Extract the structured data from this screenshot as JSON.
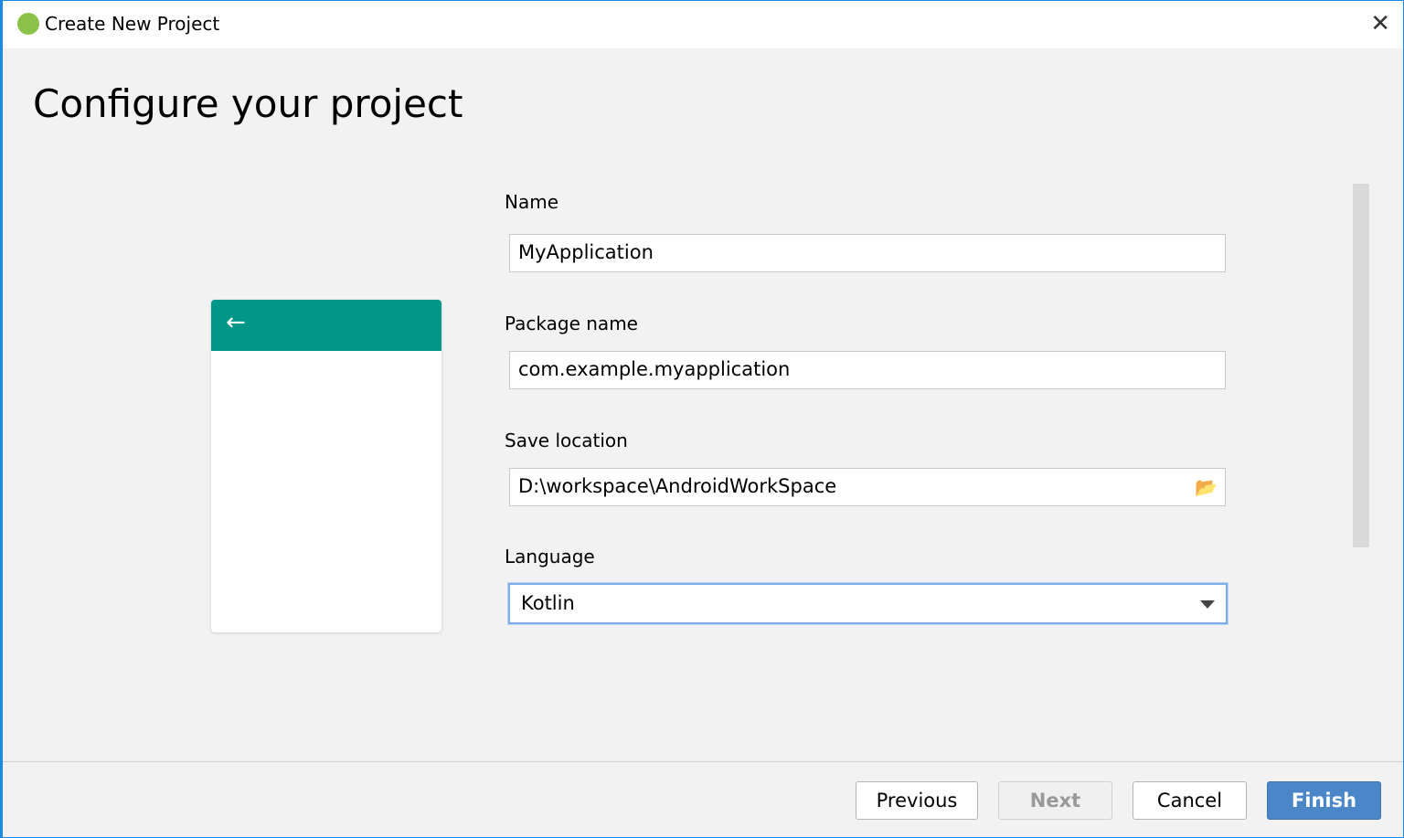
{
  "window": {
    "title": "Create New Project",
    "close_icon": "close-icon",
    "app_icon": "android-studio-icon"
  },
  "page": {
    "heading": "Configure your project"
  },
  "preview": {
    "toolbar_color": "#009688",
    "back_icon": "arrow-left-icon",
    "back_glyph": "←"
  },
  "form": {
    "name": {
      "label": "Name",
      "value": "MyApplication"
    },
    "package": {
      "label": "Package name",
      "value": "com.example.myapplication"
    },
    "location": {
      "label": "Save location",
      "value": "D:\\workspace\\AndroidWorkSpace",
      "icon": "folder-open-icon"
    },
    "language": {
      "label": "Language",
      "value": "Kotlin"
    }
  },
  "buttons": {
    "previous": "Previous",
    "next": "Next",
    "cancel": "Cancel",
    "finish": "Finish"
  },
  "colors": {
    "accent": "#4a86c8"
  }
}
